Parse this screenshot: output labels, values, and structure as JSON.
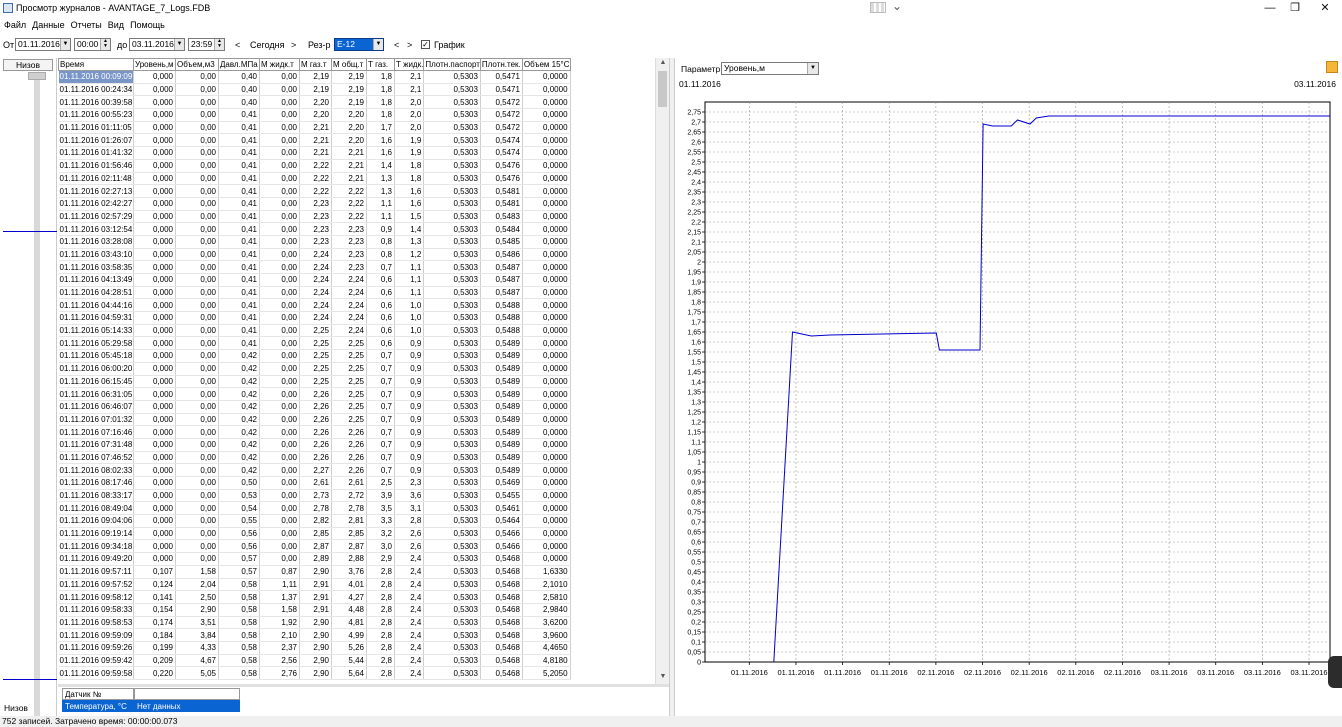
{
  "window": {
    "title": "Просмотр журналов - AVANTAGE_7_Logs.FDB",
    "minimize": "—",
    "restore": "❐",
    "close": "✕"
  },
  "menu": [
    "Файл",
    "Данные",
    "Отчеты",
    "Вид",
    "Помощь"
  ],
  "filter": {
    "from_label": "От",
    "from_date": "01.11.2016",
    "from_time": "00:00",
    "to_label": "до",
    "to_date": "03.11.2016",
    "to_time": "23:59",
    "prev": "<",
    "today": "Сегодня",
    "next": ">",
    "tank_label": "Рез-р",
    "tank_value": "Е-12",
    "tank_prev": "<",
    "tank_next": ">",
    "chart_checkbox_label": "График",
    "chart_checked": true
  },
  "left_strip": {
    "header": "Низов",
    "footer": "Низов"
  },
  "table": {
    "columns": [
      "Время",
      "Уровень,м",
      "Объем,м3",
      "Давл.МПа",
      "М жидк.т",
      "М газ.т",
      "М общ.т",
      "Т газ.",
      "Т жидк.",
      "Плотн.паспорт",
      "Плотн.тек.",
      "Объем 15°С"
    ],
    "selected_row": 0,
    "rows": [
      [
        "01.11.2016 00:09:09",
        "0,000",
        "0,00",
        "0,40",
        "0,00",
        "2,19",
        "2,19",
        "1,8",
        "2,1",
        "0,5303",
        "0,5471",
        "0,0000"
      ],
      [
        "01.11.2016 00:24:34",
        "0,000",
        "0,00",
        "0,40",
        "0,00",
        "2,19",
        "2,19",
        "1,8",
        "2,1",
        "0,5303",
        "0,5471",
        "0,0000"
      ],
      [
        "01.11.2016 00:39:58",
        "0,000",
        "0,00",
        "0,40",
        "0,00",
        "2,20",
        "2,19",
        "1,8",
        "2,0",
        "0,5303",
        "0,5472",
        "0,0000"
      ],
      [
        "01.11.2016 00:55:23",
        "0,000",
        "0,00",
        "0,41",
        "0,00",
        "2,20",
        "2,20",
        "1,8",
        "2,0",
        "0,5303",
        "0,5472",
        "0,0000"
      ],
      [
        "01.11.2016 01:11:05",
        "0,000",
        "0,00",
        "0,41",
        "0,00",
        "2,21",
        "2,20",
        "1,7",
        "2,0",
        "0,5303",
        "0,5472",
        "0,0000"
      ],
      [
        "01.11.2016 01:26:07",
        "0,000",
        "0,00",
        "0,41",
        "0,00",
        "2,21",
        "2,20",
        "1,6",
        "1,9",
        "0,5303",
        "0,5474",
        "0,0000"
      ],
      [
        "01.11.2016 01:41:32",
        "0,000",
        "0,00",
        "0,41",
        "0,00",
        "2,21",
        "2,21",
        "1,6",
        "1,9",
        "0,5303",
        "0,5474",
        "0,0000"
      ],
      [
        "01.11.2016 01:56:46",
        "0,000",
        "0,00",
        "0,41",
        "0,00",
        "2,22",
        "2,21",
        "1,4",
        "1,8",
        "0,5303",
        "0,5476",
        "0,0000"
      ],
      [
        "01.11.2016 02:11:48",
        "0,000",
        "0,00",
        "0,41",
        "0,00",
        "2,22",
        "2,21",
        "1,3",
        "1,8",
        "0,5303",
        "0,5476",
        "0,0000"
      ],
      [
        "01.11.2016 02:27:13",
        "0,000",
        "0,00",
        "0,41",
        "0,00",
        "2,22",
        "2,22",
        "1,3",
        "1,6",
        "0,5303",
        "0,5481",
        "0,0000"
      ],
      [
        "01.11.2016 02:42:27",
        "0,000",
        "0,00",
        "0,41",
        "0,00",
        "2,23",
        "2,22",
        "1,1",
        "1,6",
        "0,5303",
        "0,5481",
        "0,0000"
      ],
      [
        "01.11.2016 02:57:29",
        "0,000",
        "0,00",
        "0,41",
        "0,00",
        "2,23",
        "2,22",
        "1,1",
        "1,5",
        "0,5303",
        "0,5483",
        "0,0000"
      ],
      [
        "01.11.2016 03:12:54",
        "0,000",
        "0,00",
        "0,41",
        "0,00",
        "2,23",
        "2,23",
        "0,9",
        "1,4",
        "0,5303",
        "0,5484",
        "0,0000"
      ],
      [
        "01.11.2016 03:28:08",
        "0,000",
        "0,00",
        "0,41",
        "0,00",
        "2,23",
        "2,23",
        "0,8",
        "1,3",
        "0,5303",
        "0,5485",
        "0,0000"
      ],
      [
        "01.11.2016 03:43:10",
        "0,000",
        "0,00",
        "0,41",
        "0,00",
        "2,24",
        "2,23",
        "0,8",
        "1,2",
        "0,5303",
        "0,5486",
        "0,0000"
      ],
      [
        "01.11.2016 03:58:35",
        "0,000",
        "0,00",
        "0,41",
        "0,00",
        "2,24",
        "2,23",
        "0,7",
        "1,1",
        "0,5303",
        "0,5487",
        "0,0000"
      ],
      [
        "01.11.2016 04:13:49",
        "0,000",
        "0,00",
        "0,41",
        "0,00",
        "2,24",
        "2,24",
        "0,6",
        "1,1",
        "0,5303",
        "0,5487",
        "0,0000"
      ],
      [
        "01.11.2016 04:28:51",
        "0,000",
        "0,00",
        "0,41",
        "0,00",
        "2,24",
        "2,24",
        "0,6",
        "1,1",
        "0,5303",
        "0,5487",
        "0,0000"
      ],
      [
        "01.11.2016 04:44:16",
        "0,000",
        "0,00",
        "0,41",
        "0,00",
        "2,24",
        "2,24",
        "0,6",
        "1,0",
        "0,5303",
        "0,5488",
        "0,0000"
      ],
      [
        "01.11.2016 04:59:31",
        "0,000",
        "0,00",
        "0,41",
        "0,00",
        "2,24",
        "2,24",
        "0,6",
        "1,0",
        "0,5303",
        "0,5488",
        "0,0000"
      ],
      [
        "01.11.2016 05:14:33",
        "0,000",
        "0,00",
        "0,41",
        "0,00",
        "2,25",
        "2,24",
        "0,6",
        "1,0",
        "0,5303",
        "0,5488",
        "0,0000"
      ],
      [
        "01.11.2016 05:29:58",
        "0,000",
        "0,00",
        "0,41",
        "0,00",
        "2,25",
        "2,25",
        "0,6",
        "0,9",
        "0,5303",
        "0,5489",
        "0,0000"
      ],
      [
        "01.11.2016 05:45:18",
        "0,000",
        "0,00",
        "0,42",
        "0,00",
        "2,25",
        "2,25",
        "0,7",
        "0,9",
        "0,5303",
        "0,5489",
        "0,0000"
      ],
      [
        "01.11.2016 06:00:20",
        "0,000",
        "0,00",
        "0,42",
        "0,00",
        "2,25",
        "2,25",
        "0,7",
        "0,9",
        "0,5303",
        "0,5489",
        "0,0000"
      ],
      [
        "01.11.2016 06:15:45",
        "0,000",
        "0,00",
        "0,42",
        "0,00",
        "2,25",
        "2,25",
        "0,7",
        "0,9",
        "0,5303",
        "0,5489",
        "0,0000"
      ],
      [
        "01.11.2016 06:31:05",
        "0,000",
        "0,00",
        "0,42",
        "0,00",
        "2,26",
        "2,25",
        "0,7",
        "0,9",
        "0,5303",
        "0,5489",
        "0,0000"
      ],
      [
        "01.11.2016 06:46:07",
        "0,000",
        "0,00",
        "0,42",
        "0,00",
        "2,26",
        "2,25",
        "0,7",
        "0,9",
        "0,5303",
        "0,5489",
        "0,0000"
      ],
      [
        "01.11.2016 07:01:32",
        "0,000",
        "0,00",
        "0,42",
        "0,00",
        "2,26",
        "2,25",
        "0,7",
        "0,9",
        "0,5303",
        "0,5489",
        "0,0000"
      ],
      [
        "01.11.2016 07:16:46",
        "0,000",
        "0,00",
        "0,42",
        "0,00",
        "2,26",
        "2,26",
        "0,7",
        "0,9",
        "0,5303",
        "0,5489",
        "0,0000"
      ],
      [
        "01.11.2016 07:31:48",
        "0,000",
        "0,00",
        "0,42",
        "0,00",
        "2,26",
        "2,26",
        "0,7",
        "0,9",
        "0,5303",
        "0,5489",
        "0,0000"
      ],
      [
        "01.11.2016 07:46:52",
        "0,000",
        "0,00",
        "0,42",
        "0,00",
        "2,26",
        "2,26",
        "0,7",
        "0,9",
        "0,5303",
        "0,5489",
        "0,0000"
      ],
      [
        "01.11.2016 08:02:33",
        "0,000",
        "0,00",
        "0,42",
        "0,00",
        "2,27",
        "2,26",
        "0,7",
        "0,9",
        "0,5303",
        "0,5489",
        "0,0000"
      ],
      [
        "01.11.2016 08:17:46",
        "0,000",
        "0,00",
        "0,50",
        "0,00",
        "2,61",
        "2,61",
        "2,5",
        "2,3",
        "0,5303",
        "0,5469",
        "0,0000"
      ],
      [
        "01.11.2016 08:33:17",
        "0,000",
        "0,00",
        "0,53",
        "0,00",
        "2,73",
        "2,72",
        "3,9",
        "3,6",
        "0,5303",
        "0,5455",
        "0,0000"
      ],
      [
        "01.11.2016 08:49:04",
        "0,000",
        "0,00",
        "0,54",
        "0,00",
        "2,78",
        "2,78",
        "3,5",
        "3,1",
        "0,5303",
        "0,5461",
        "0,0000"
      ],
      [
        "01.11.2016 09:04:06",
        "0,000",
        "0,00",
        "0,55",
        "0,00",
        "2,82",
        "2,81",
        "3,3",
        "2,8",
        "0,5303",
        "0,5464",
        "0,0000"
      ],
      [
        "01.11.2016 09:19:14",
        "0,000",
        "0,00",
        "0,56",
        "0,00",
        "2,85",
        "2,85",
        "3,2",
        "2,6",
        "0,5303",
        "0,5466",
        "0,0000"
      ],
      [
        "01.11.2016 09:34:18",
        "0,000",
        "0,00",
        "0,56",
        "0,00",
        "2,87",
        "2,87",
        "3,0",
        "2,6",
        "0,5303",
        "0,5466",
        "0,0000"
      ],
      [
        "01.11.2016 09:49:20",
        "0,000",
        "0,00",
        "0,57",
        "0,00",
        "2,89",
        "2,88",
        "2,9",
        "2,4",
        "0,5303",
        "0,5468",
        "0,0000"
      ],
      [
        "01.11.2016 09:57:11",
        "0,107",
        "1,58",
        "0,57",
        "0,87",
        "2,90",
        "3,76",
        "2,8",
        "2,4",
        "0,5303",
        "0,5468",
        "1,6330"
      ],
      [
        "01.11.2016 09:57:52",
        "0,124",
        "2,04",
        "0,58",
        "1,11",
        "2,91",
        "4,01",
        "2,8",
        "2,4",
        "0,5303",
        "0,5468",
        "2,1010"
      ],
      [
        "01.11.2016 09:58:12",
        "0,141",
        "2,50",
        "0,58",
        "1,37",
        "2,91",
        "4,27",
        "2,8",
        "2,4",
        "0,5303",
        "0,5468",
        "2,5810"
      ],
      [
        "01.11.2016 09:58:33",
        "0,154",
        "2,90",
        "0,58",
        "1,58",
        "2,91",
        "4,48",
        "2,8",
        "2,4",
        "0,5303",
        "0,5468",
        "2,9840"
      ],
      [
        "01.11.2016 09:58:53",
        "0,174",
        "3,51",
        "0,58",
        "1,92",
        "2,90",
        "4,81",
        "2,8",
        "2,4",
        "0,5303",
        "0,5468",
        "3,6200"
      ],
      [
        "01.11.2016 09:59:09",
        "0,184",
        "3,84",
        "0,58",
        "2,10",
        "2,90",
        "4,99",
        "2,8",
        "2,4",
        "0,5303",
        "0,5468",
        "3,9600"
      ],
      [
        "01.11.2016 09:59:26",
        "0,199",
        "4,33",
        "0,58",
        "2,37",
        "2,90",
        "5,26",
        "2,8",
        "2,4",
        "0,5303",
        "0,5468",
        "4,4650"
      ],
      [
        "01.11.2016 09:59:42",
        "0,209",
        "4,67",
        "0,58",
        "2,56",
        "2,90",
        "5,44",
        "2,8",
        "2,4",
        "0,5303",
        "0,5468",
        "4,8180"
      ],
      [
        "01.11.2016 09:59:58",
        "0,220",
        "5,05",
        "0,58",
        "2,76",
        "2,90",
        "5,64",
        "2,8",
        "2,4",
        "0,5303",
        "0,5468",
        "5,2050"
      ]
    ]
  },
  "sensors": {
    "header": [
      "Датчик №",
      ""
    ],
    "rows": [
      [
        "Температура, °С",
        "Нет данных"
      ]
    ]
  },
  "chart_panel": {
    "param_label": "Параметр",
    "param_value": "Уровень,м",
    "date_start": "01.11.2016",
    "date_end": "03.11.2016"
  },
  "chart_data": {
    "type": "line",
    "title": "",
    "xlabel": "",
    "ylabel": "",
    "ylim": [
      0,
      2.8
    ],
    "y_ticks": [
      "0",
      "0,05",
      "0,1",
      "0,15",
      "0,2",
      "0,25",
      "0,3",
      "0,35",
      "0,4",
      "0,45",
      "0,5",
      "0,55",
      "0,6",
      "0,65",
      "0,7",
      "0,75",
      "0,8",
      "0,85",
      "0,9",
      "0,95",
      "1",
      "1,05",
      "1,1",
      "1,15",
      "1,2",
      "1,25",
      "1,3",
      "1,35",
      "1,4",
      "1,45",
      "1,5",
      "1,55",
      "1,6",
      "1,65",
      "1,7",
      "1,75",
      "1,8",
      "1,85",
      "1,9",
      "1,95",
      "2",
      "2,05",
      "2,1",
      "2,15",
      "2,2",
      "2,25",
      "2,3",
      "2,35",
      "2,4",
      "2,45",
      "2,5",
      "2,55",
      "2,6",
      "2,65",
      "2,7",
      "2,75"
    ],
    "x_tick_labels": [
      "01.11.2016",
      "01.11.2016",
      "01.11.2016",
      "01.11.2016",
      "02.11.2016",
      "02.11.2016",
      "02.11.2016",
      "02.11.2016",
      "02.11.2016",
      "03.11.2016",
      "03.11.2016",
      "03.11.2016",
      "03.11.2016"
    ],
    "grid": true,
    "color": "#0000cc",
    "series": [
      {
        "x": [
          0.11,
          0.14,
          0.17,
          0.2,
          0.37,
          0.375,
          0.39,
          0.44,
          0.445,
          0.46,
          0.49,
          0.5,
          0.52,
          0.53,
          0.55,
          1.0
        ],
        "y": [
          0,
          1.65,
          1.63,
          1.635,
          1.645,
          1.56,
          1.56,
          1.56,
          2.69,
          2.68,
          2.68,
          2.71,
          2.69,
          2.72,
          2.73,
          2.73
        ]
      }
    ]
  },
  "status": "752 записей. Затрачено время: 00:00:00.073"
}
